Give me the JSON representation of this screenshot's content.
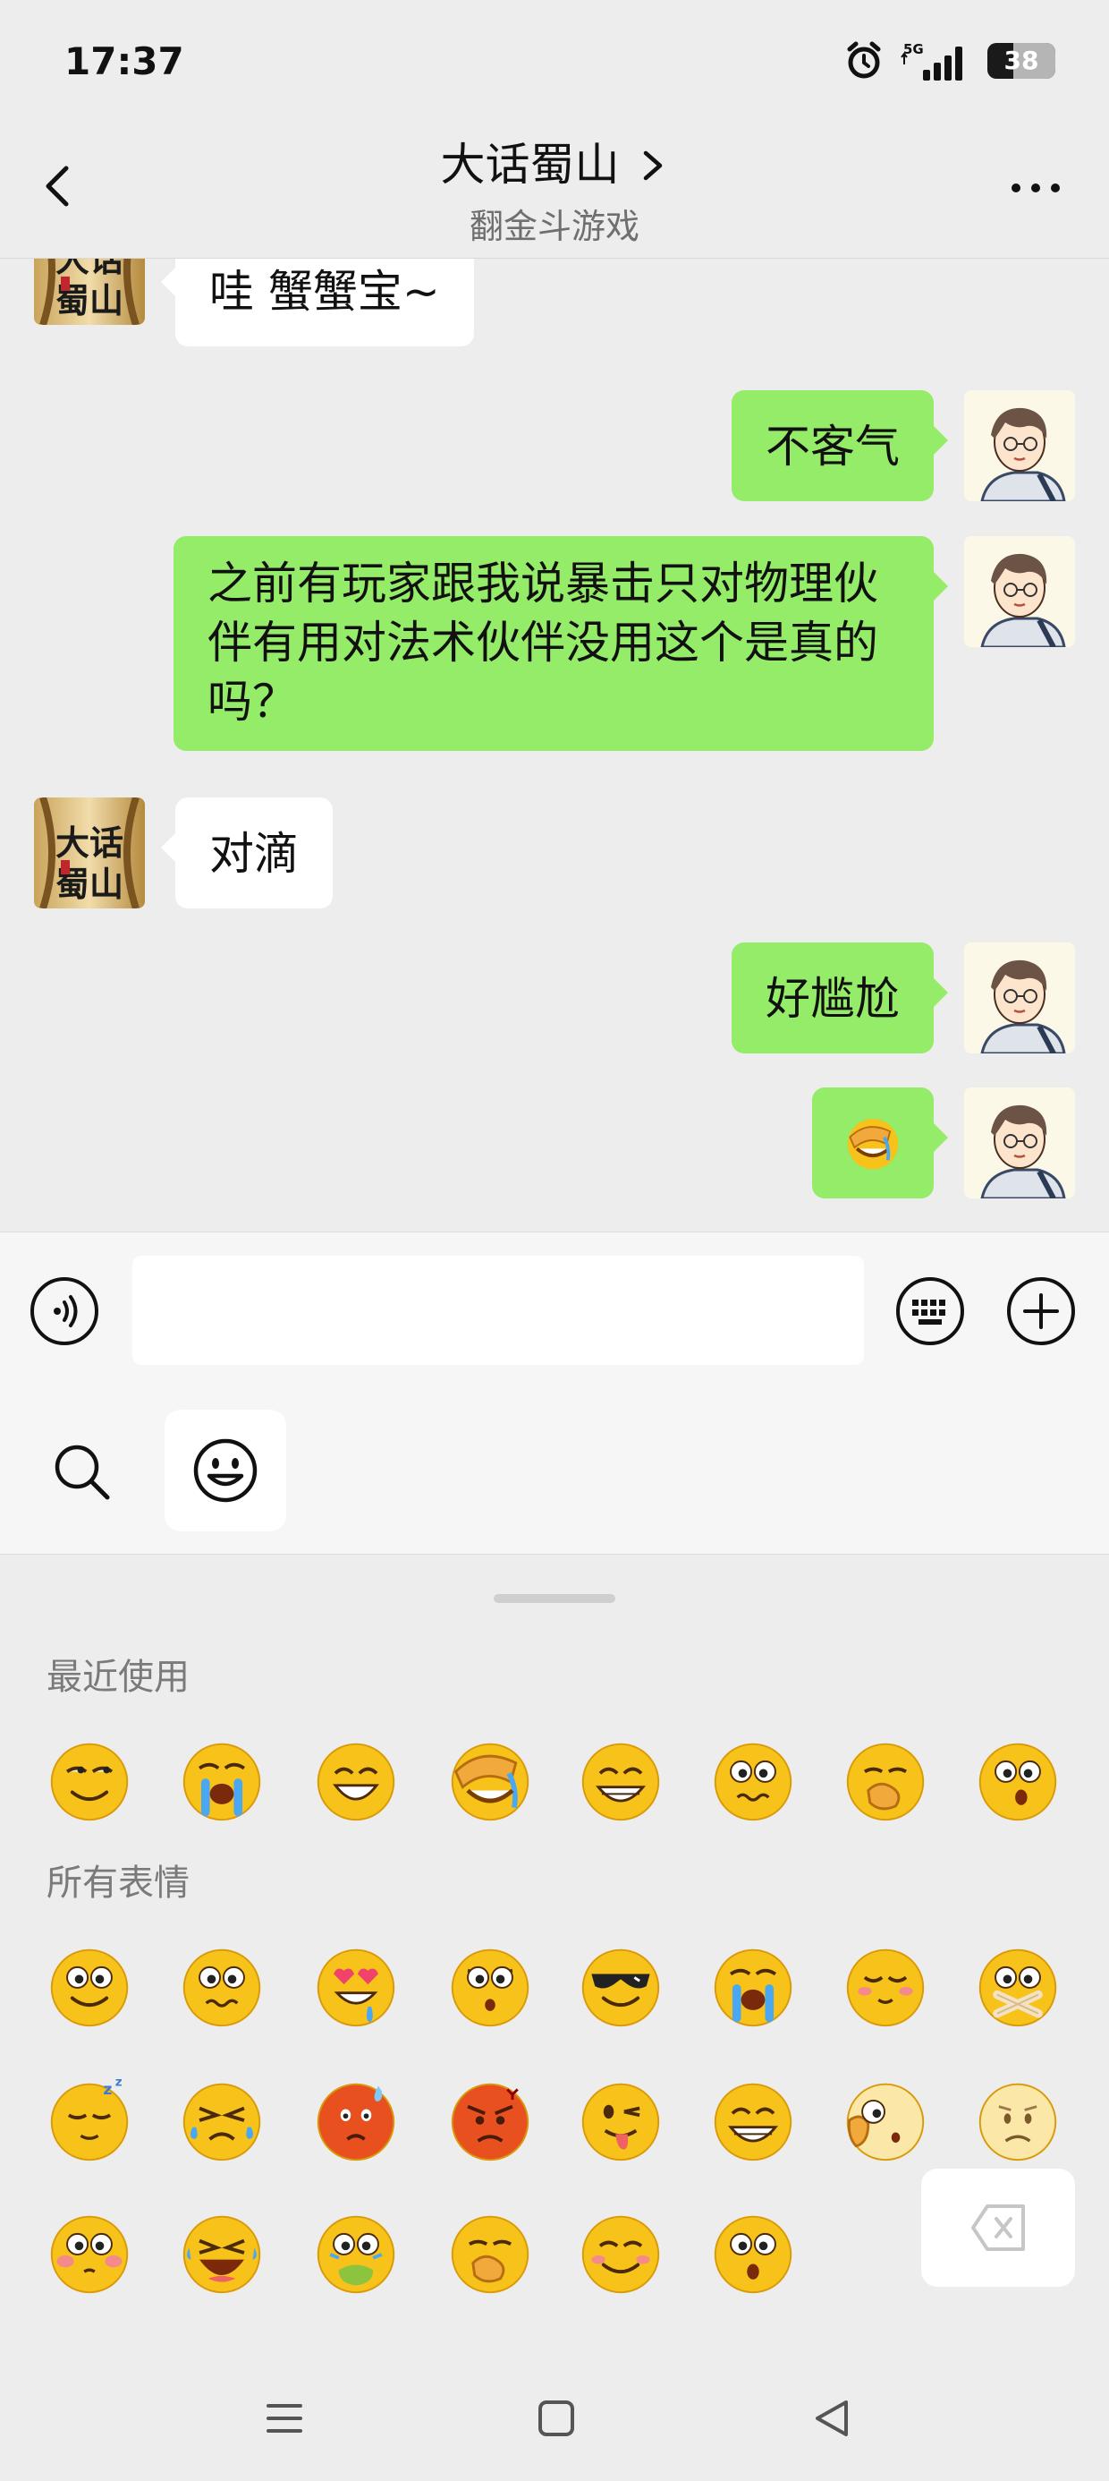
{
  "status_bar": {
    "time": "17:37",
    "network": "5G",
    "battery": "38",
    "battery_level": 0.38
  },
  "header": {
    "title": "大话蜀山",
    "subtitle": "翻金斗游戏"
  },
  "messages": [
    {
      "side": "in",
      "text": "哇 蟹蟹宝~"
    },
    {
      "side": "out",
      "text": "不客气"
    },
    {
      "side": "out",
      "lines": [
        "之前有玩家跟我说暴击只对物理伙",
        "伴有用对法术伙伴没用这个是真的",
        "吗？"
      ]
    },
    {
      "side": "in",
      "text": "对滴"
    },
    {
      "side": "out",
      "text": "好尴尬"
    },
    {
      "side": "out",
      "emoji": "facepalm-emoji"
    }
  ],
  "contact_avatar": {
    "caption_top": "大话",
    "caption_bottom": "蜀山"
  },
  "input_bar": {
    "voice_icon": "voice-icon",
    "keyboard_icon": "keyboard-icon",
    "plus_icon": "plus-icon",
    "tabs": [
      "search-icon",
      "smiley-icon"
    ]
  },
  "emoji_panel": {
    "recent_label": "最近使用",
    "all_label": "所有表情",
    "recent": [
      "sly-smile",
      "loud-cry",
      "grin",
      "facepalm",
      "big-grin",
      "wavy-worried",
      "hand-over-mouth",
      "surprised"
    ],
    "all": [
      [
        "smile",
        "wavy-worried",
        "heart-eyes-drool",
        "shocked",
        "sunglasses",
        "loud-cry",
        "shy-blush",
        "zipped-mouth"
      ],
      [
        "sleepy",
        "scrunch-cry",
        "sweat-angry",
        "angry",
        "tongue-wink",
        "big-grin",
        "thinking-peek",
        "sad"
      ],
      [
        "flushed",
        "laugh-cry",
        "nauseous",
        "hand-over-mouth",
        "content",
        "open-mouth"
      ]
    ],
    "delete_icon": "backspace-icon"
  },
  "nav_bar": [
    "menu-icon",
    "home-icon",
    "back-icon"
  ],
  "colors": {
    "background": "#ededed",
    "bubble_out": "#95ec69",
    "bubble_in": "#ffffff",
    "emoji_yellow": "#f7c21a",
    "emoji_red": "#e8501f"
  }
}
